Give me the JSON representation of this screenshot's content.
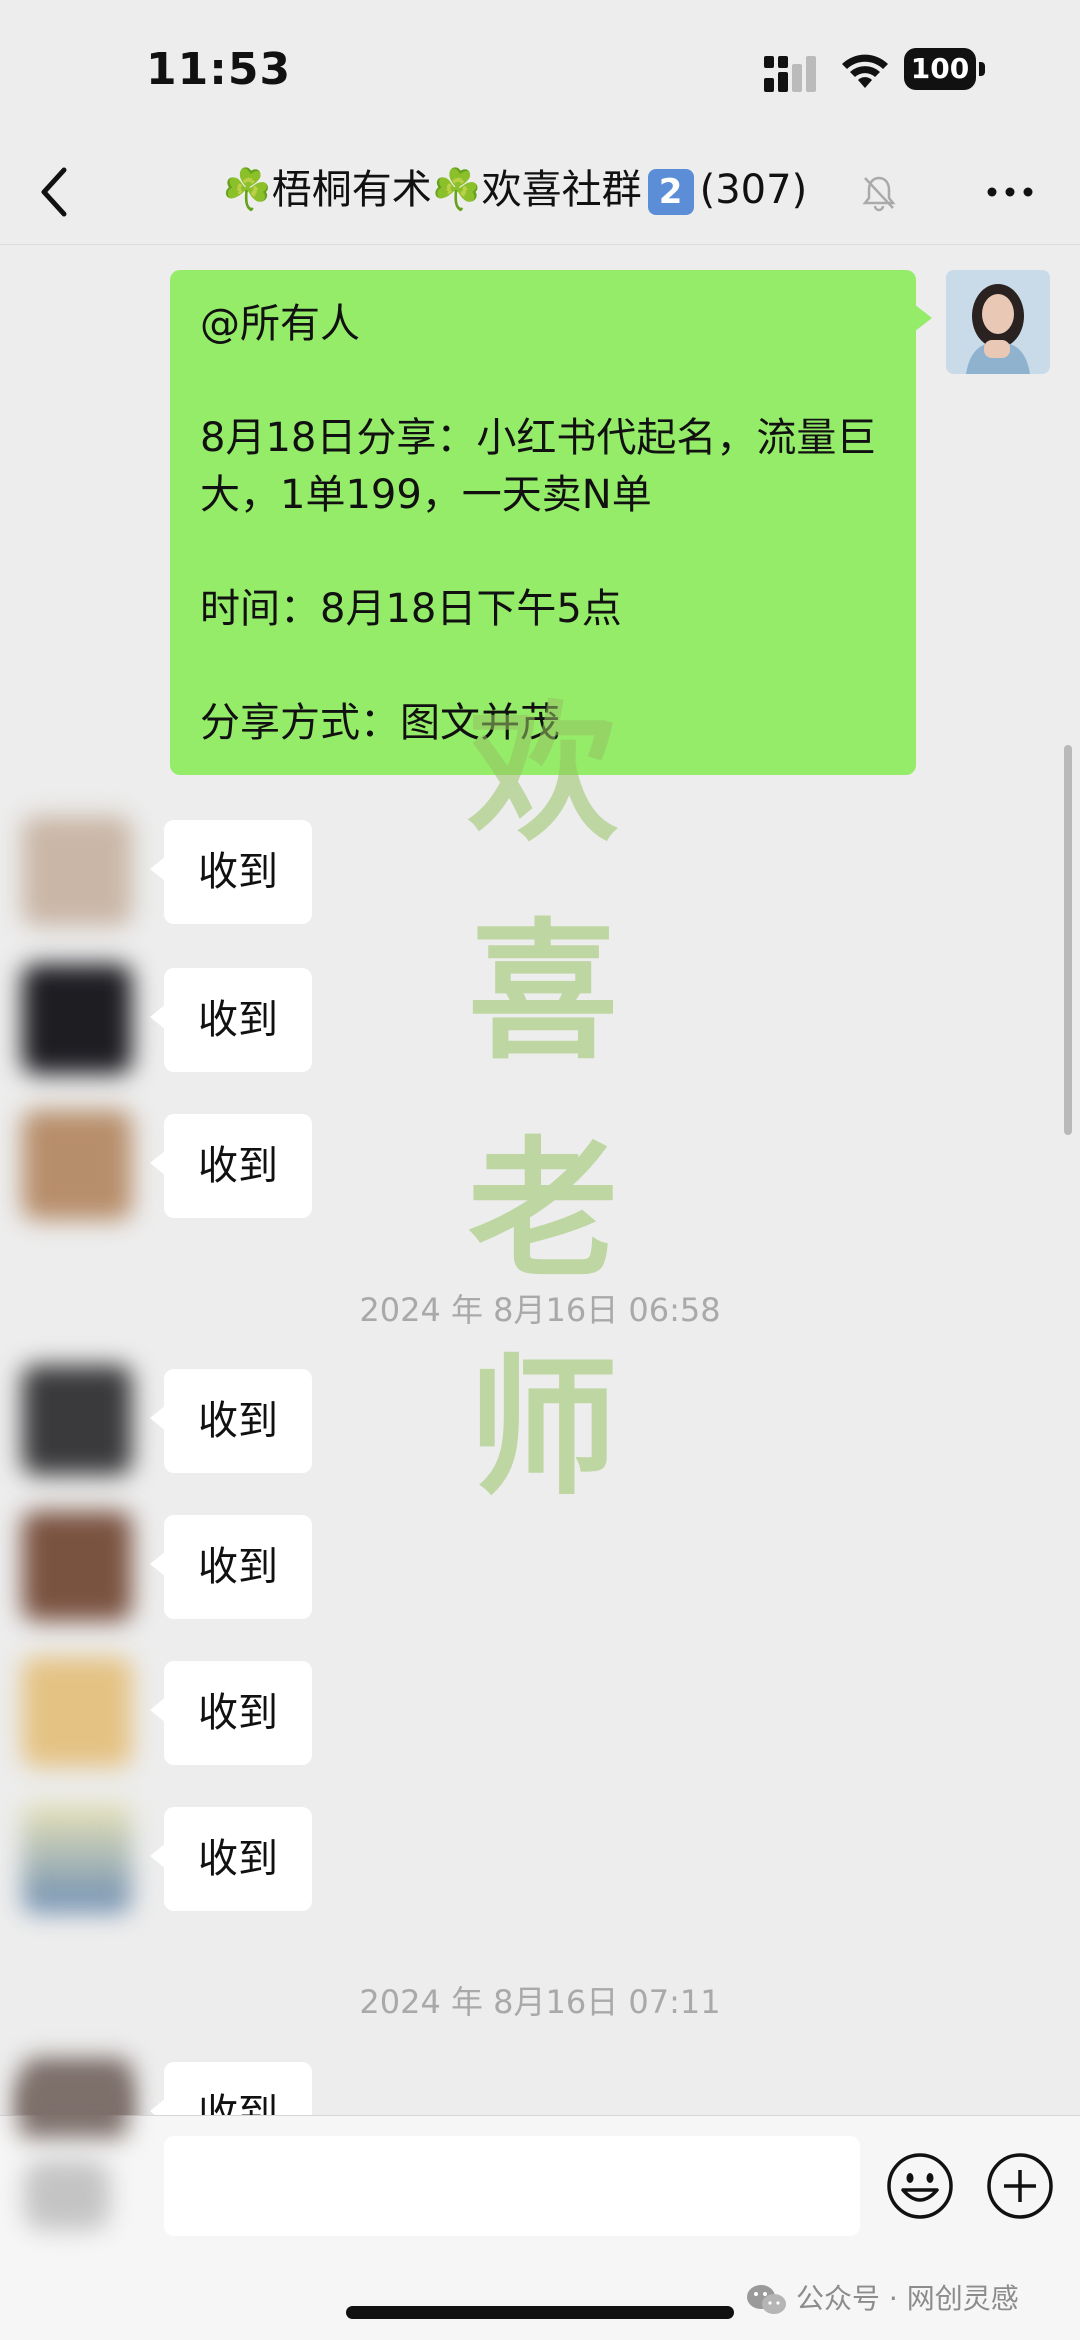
{
  "status": {
    "time": "11:53",
    "battery": "100"
  },
  "nav": {
    "title_prefix": "☘️梧桐有术☘️欢喜社群",
    "title_badge": "2",
    "title_count": "(307)"
  },
  "pinned_message": {
    "lines": [
      "@所有人",
      "",
      "8月18日分享：小红书代起名，流量巨大，1单199，一天卖N单",
      "",
      "时间：8月18日下午5点",
      "",
      "分享方式：图文并茂"
    ]
  },
  "watermark": [
    "欢",
    "喜",
    "老",
    "师"
  ],
  "replies": [
    "收到",
    "收到",
    "收到",
    "收到",
    "收到",
    "收到",
    "收到",
    "收到"
  ],
  "timestamps": [
    "2024 年 8月16日 06:58",
    "2024 年 8月16日 07:11"
  ],
  "footer": {
    "credit": "公众号 · 网创灵感"
  },
  "colors": {
    "self_bubble": "#95ec69",
    "background": "#ededed"
  }
}
